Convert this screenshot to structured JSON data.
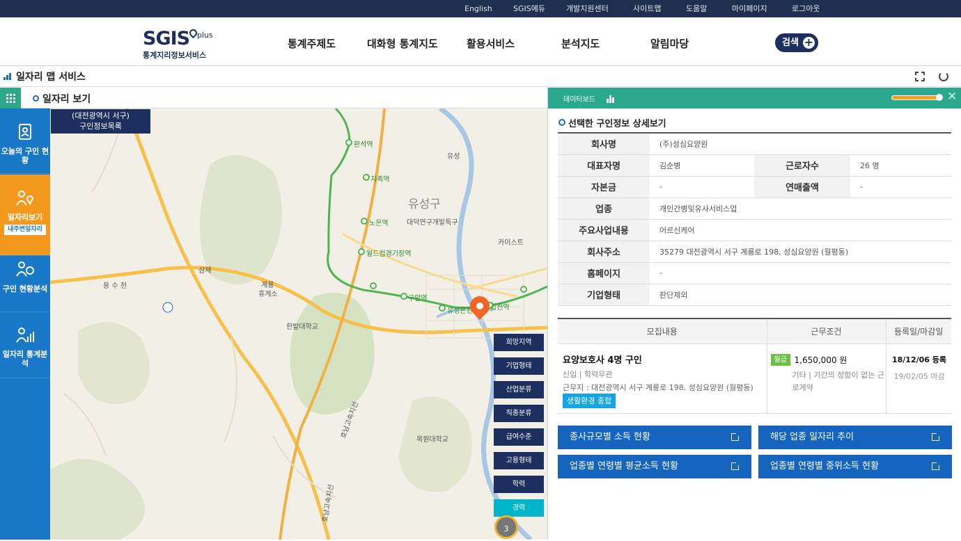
{
  "topbar": {
    "links": [
      "English",
      "SGIS에듀",
      "개발지원센터",
      "사이트맵",
      "도움말",
      "마이페이지",
      "로그아웃"
    ]
  },
  "header": {
    "logo_main": "SGIS",
    "logo_plus": "plus",
    "logo_sub": "통계지리정보서비스",
    "menu": [
      "통계주제도",
      "대화형 통계지도",
      "활용서비스",
      "분석지도",
      "알림마당"
    ],
    "search_label": "검색"
  },
  "titlebar": {
    "title": "일자리 맵 서비스"
  },
  "subbar": {
    "title": "일자리 보기"
  },
  "sidenav": [
    {
      "label": "오늘의 구인 현황",
      "icon": "clipboard-person-icon"
    },
    {
      "label": "일자리보기",
      "tag": "내주변일자리",
      "icon": "person-pin-icon"
    },
    {
      "label": "구인 현황분석",
      "icon": "people-icon"
    },
    {
      "label": "일자리 통계분석",
      "icon": "person-chart-icon"
    }
  ],
  "map": {
    "list_badge_line1": "(대전광역시 서구)",
    "list_badge_line2": "구인정보목록",
    "labels": {
      "yuseong_gu": "유성구",
      "daedeok": "대덕연구개발특구",
      "kaist": "카이스트",
      "samjae": "삼재",
      "yuseong_ic": "유성",
      "gyeryong": "계룡",
      "gyeryong2": "휴게소",
      "hanbat": "한밭대학교",
      "mokwon": "목원대학교",
      "road_yongsu": "용 수 천",
      "highway1": "호남고속지선",
      "highway2": "호남고속지선",
      "route1": "1"
    },
    "stations": [
      "판석역",
      "지족역",
      "노은역",
      "월드컵경기장역",
      "구암역",
      "유성온천역",
      "갑천역"
    ],
    "filter_buttons": [
      "희망지역",
      "기업형태",
      "산업분류",
      "직종분류",
      "급여수준",
      "고용형태",
      "학력",
      "경력"
    ],
    "active_filter": "경력",
    "cluster_count": "3"
  },
  "panel": {
    "header": "데이터보드",
    "section_title": "선택한 구인정보 상세보기",
    "details": {
      "company_label": "회사명",
      "company": "(주)성심요양원",
      "ceo_label": "대표자명",
      "ceo": "김순병",
      "workers_label": "근로자수",
      "workers": "26 명",
      "capital_label": "자본금",
      "capital": "-",
      "sales_label": "연매출액",
      "sales": "-",
      "industry_label": "업종",
      "industry": "개인간병및유사서비스업",
      "business_label": "주요사업내용",
      "business": "어르신케어",
      "address_label": "회사주소",
      "address": "35279 대전광역시 서구 계룡로 198, 성심요양원 (월평동)",
      "homepage_label": "홈페이지",
      "homepage": "-",
      "type_label": "기업형태",
      "type": "판단제외"
    },
    "jobs": {
      "headers": [
        "모집내용",
        "근무조건",
        "등록일/마감일"
      ],
      "title": "요양보호사 4명 구인",
      "meta": "신입  |  학력무관",
      "workplace": "근무지 : 대전광역시 서구 계룡로 198, 성심요양원 (월평동)",
      "tag": "생활환경 종합",
      "wage_type": "월급",
      "wage": "1,650,000 원",
      "etc": "기타 | 기간의 정함이 없는 근로계약",
      "reg": "18/12/06 등록",
      "deadline": "19/02/05 마감"
    },
    "links": [
      "종사규모별 소득 현황",
      "해당 업종 일자리 추이",
      "업종별 연령별 평균소득 현황",
      "업종별 연령별 중위소득 현황"
    ]
  }
}
